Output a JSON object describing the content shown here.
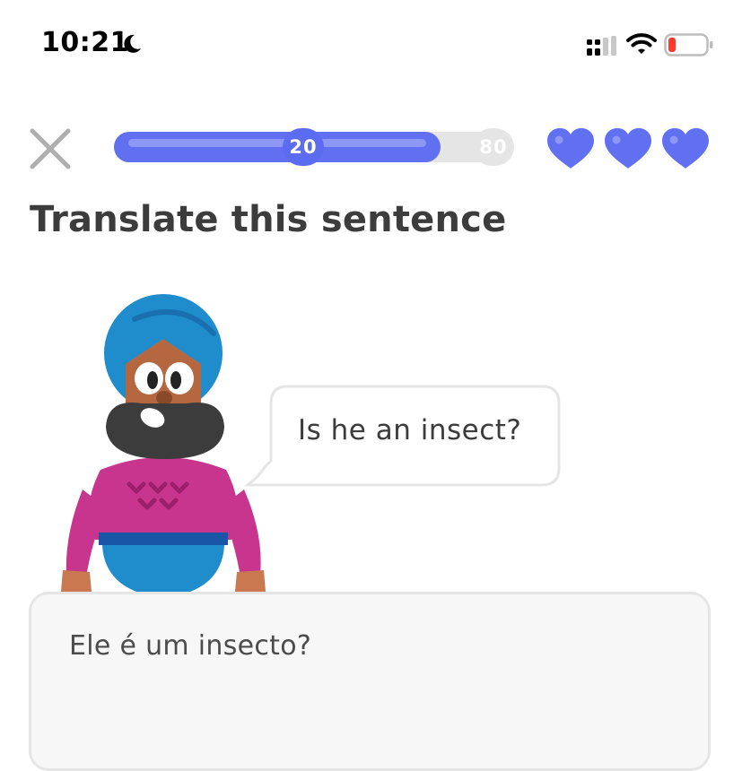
{
  "status_bar": {
    "time": "10:21",
    "icons": [
      "moon-icon",
      "cellular-signal-icon",
      "wifi-icon",
      "battery-low-icon"
    ]
  },
  "header": {
    "close_icon": "close-icon",
    "progress": {
      "current_label": "20",
      "target_label": "80",
      "fraction": 0.82
    },
    "hearts": {
      "count": 3,
      "icon": "heart-icon",
      "color": "#6170f0"
    }
  },
  "prompt": {
    "title": "Translate this sentence",
    "speech_bubble_text": "Is he an insect?"
  },
  "answer": {
    "value": "Ele é um insecto?"
  },
  "colors": {
    "accent": "#6170f0",
    "title_text": "#3c3c3c",
    "border": "#e5e5e5",
    "answer_bg": "#f7f7f7"
  }
}
